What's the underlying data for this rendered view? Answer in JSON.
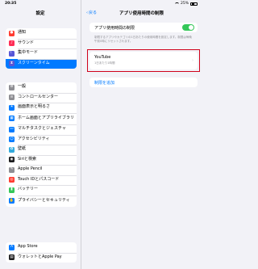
{
  "status_bar": {
    "time": "20:35",
    "battery": "25%"
  },
  "sidebar": {
    "title": "設定",
    "groups": [
      {
        "items": [
          {
            "label": "通知",
            "icon": "bell-icon",
            "color": "#ff3b30",
            "glyph": "●"
          },
          {
            "label": "サウンド",
            "icon": "speaker-icon",
            "color": "#ff2d55",
            "glyph": "♪"
          },
          {
            "label": "集中モード",
            "icon": "moon-icon",
            "color": "#5856d6",
            "glyph": "☾"
          },
          {
            "label": "スクリーンタイム",
            "icon": "hourglass-icon",
            "color": "#5856d6",
            "glyph": "⧗",
            "selected": true
          }
        ]
      },
      {
        "items": [
          {
            "label": "一般",
            "icon": "gear-icon",
            "color": "#8e8e93",
            "glyph": "⚙"
          },
          {
            "label": "コントロールセンター",
            "icon": "control-center-icon",
            "color": "#8e8e93",
            "glyph": "≡"
          },
          {
            "label": "画面表示と明るさ",
            "icon": "brightness-icon",
            "color": "#007aff",
            "glyph": "☀"
          },
          {
            "label": "ホーム画面とアプリライブラリ",
            "icon": "home-screen-icon",
            "color": "#007aff",
            "glyph": "▦",
            "tall": true
          },
          {
            "label": "マルチタスクとジェスチャ",
            "icon": "multitask-icon",
            "color": "#007aff",
            "glyph": "▭"
          },
          {
            "label": "アクセシビリティ",
            "icon": "accessibility-icon",
            "color": "#007aff",
            "glyph": "☺"
          },
          {
            "label": "壁紙",
            "icon": "wallpaper-icon",
            "color": "#34aadc",
            "glyph": "✿"
          },
          {
            "label": "Siriと検索",
            "icon": "siri-icon",
            "color": "#1c1c1e",
            "glyph": "◉"
          },
          {
            "label": "Apple Pencil",
            "icon": "pencil-icon",
            "color": "#8e8e93",
            "glyph": "✎"
          },
          {
            "label": "Touch IDとパスコード",
            "icon": "fingerprint-icon",
            "color": "#ff3b30",
            "glyph": "◎"
          },
          {
            "label": "バッテリー",
            "icon": "battery-icon",
            "color": "#34c759",
            "glyph": "▮"
          },
          {
            "label": "プライバシーとセキュリティ",
            "icon": "privacy-hand-icon",
            "color": "#007aff",
            "glyph": "✋",
            "tall": true
          }
        ]
      },
      {
        "items": [
          {
            "label": "App Store",
            "icon": "app-store-icon",
            "color": "#007aff",
            "glyph": "A"
          },
          {
            "label": "ウォレットとApple Pay",
            "icon": "wallet-icon",
            "color": "#1c1c1e",
            "glyph": "▤"
          }
        ]
      }
    ]
  },
  "main": {
    "back_label": "戻る",
    "title": "アプリ使用時間の制限",
    "toggle_label": "アプリ使用時間の制限",
    "toggle_on": true,
    "footnote": "制限するアプリやカテゴリの1日あたりの使用時間を設定します。制限は毎晩午前0時にリセットされます。",
    "limit_item": {
      "name": "YouTube",
      "subtitle": "1日あたり1時間"
    },
    "add_label": "制限を追加"
  }
}
